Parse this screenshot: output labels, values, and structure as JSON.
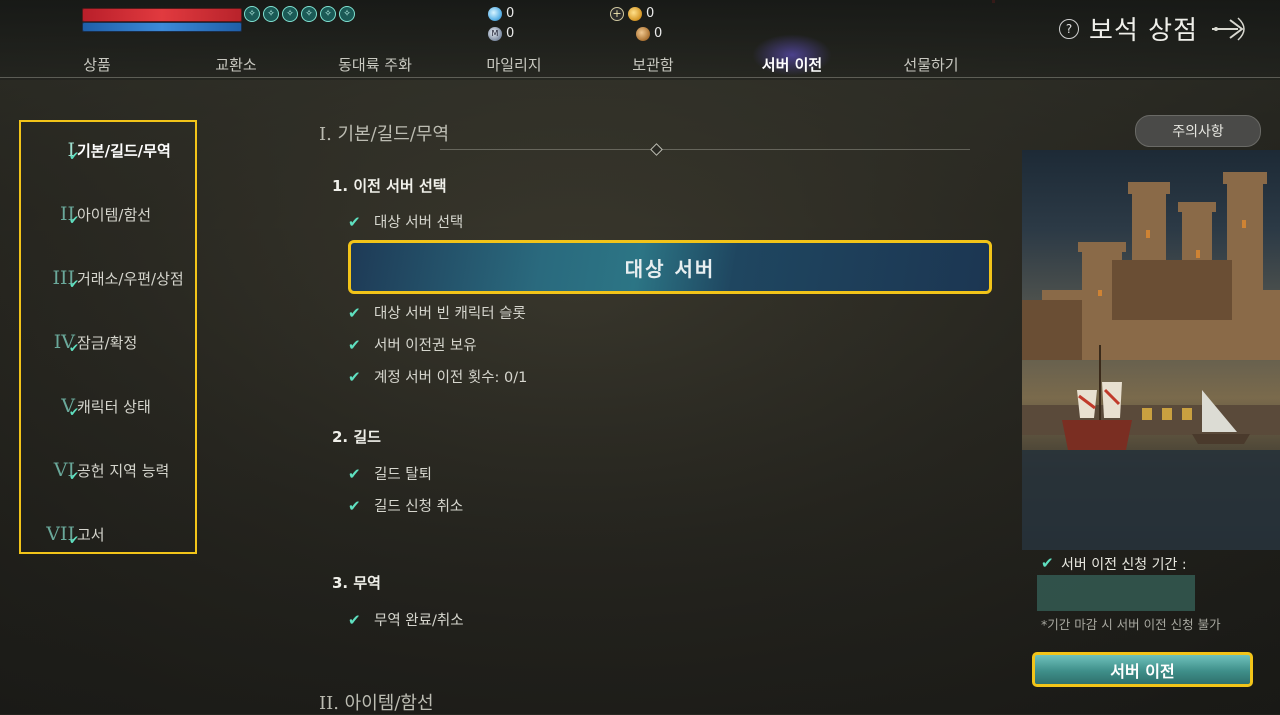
{
  "status": {
    "buff_icons": [
      "buff-icon-1",
      "buff-icon-2",
      "buff-icon-3",
      "buff-icon-4",
      "buff-icon-5",
      "buff-icon-6"
    ]
  },
  "currency": {
    "gem": "0",
    "mileage": "0",
    "gold": "0",
    "bronze": "0",
    "mileage_icon_text": "M",
    "plus_icon_text": "+"
  },
  "shop": {
    "title": "보석 상점",
    "help_icon_text": "?"
  },
  "tabs": [
    {
      "label": "상품"
    },
    {
      "label": "교환소"
    },
    {
      "label": "동대륙 주화"
    },
    {
      "label": "마일리지"
    },
    {
      "label": "보관함"
    },
    {
      "label": "서버 이전",
      "active": true
    },
    {
      "label": "선물하기"
    }
  ],
  "nav": [
    {
      "num": "I",
      "label": "기본/길드/무역",
      "active": true
    },
    {
      "num": "II",
      "label": "아이템/함선"
    },
    {
      "num": "III",
      "label": "거래소/우편/상점"
    },
    {
      "num": "IV",
      "label": "잠금/확정"
    },
    {
      "num": "V",
      "label": "캐릭터 상태"
    },
    {
      "num": "VI",
      "label": "공헌 지역 능력"
    },
    {
      "num": "VII",
      "label": "고서"
    }
  ],
  "main": {
    "section1_title": "I. 기본/길드/무역",
    "section2_title": "II. 아이템/함선",
    "sub1": "1. 이전 서버 선택",
    "sub1_items": [
      "대상 서버 선택",
      "대상 서버 빈 캐릭터 슬롯",
      "서버 이전권 보유",
      "계정 서버 이전 횟수: 0/1"
    ],
    "target_server_button": "대상 서버",
    "sub2": "2. 길드",
    "sub2_items": [
      "길드 탈퇴",
      "길드 신청 취소"
    ],
    "sub3": "3. 무역",
    "sub3_items": [
      "무역 완료/취소"
    ]
  },
  "side": {
    "notice_button": "주의사항",
    "period_label": "서버 이전 신청 기간 :",
    "period_note": "*기간 마감 시 서버 이전 신청 불가",
    "transfer_button": "서버 이전"
  },
  "colors": {
    "highlight_border": "#f2c419",
    "check": "#5fe0c0",
    "hp": "#e13a3f",
    "mp": "#3c8ad8"
  }
}
